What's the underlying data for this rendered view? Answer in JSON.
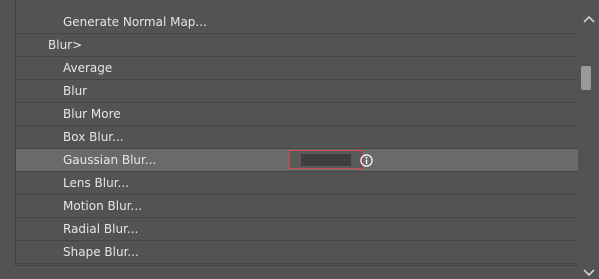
{
  "rows": [
    {
      "label": "Generate Normal Map...",
      "level": 1
    },
    {
      "label": "Blur>",
      "level": 0
    },
    {
      "label": "Average",
      "level": 1
    },
    {
      "label": "Blur",
      "level": 1
    },
    {
      "label": "Blur More",
      "level": 1
    },
    {
      "label": "Box Blur...",
      "level": 1
    },
    {
      "label": "Gaussian Blur...",
      "level": 1,
      "selected": true
    },
    {
      "label": "Lens Blur...",
      "level": 1
    },
    {
      "label": "Motion Blur...",
      "level": 1
    },
    {
      "label": "Radial Blur...",
      "level": 1
    },
    {
      "label": "Shape Blur...",
      "level": 1
    }
  ],
  "icons": {
    "info": "info-icon",
    "scroll_up": "chevron-up-icon",
    "scroll_down": "chevron-down-icon"
  },
  "colors": {
    "selected_row": "#6a6a6a",
    "shortcut_border": "#d44a52",
    "text": "#e6e6e6"
  }
}
